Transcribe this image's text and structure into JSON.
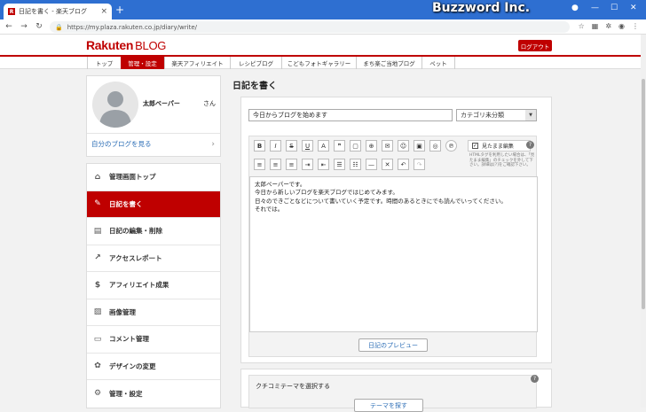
{
  "browser": {
    "tab_title": "日記を書く - 楽天ブログ",
    "url": "https://my.plaza.rakuten.co.jp/diary/write/",
    "watermark": "Buzzword Inc."
  },
  "header": {
    "logo_rakuten": "Rakuten",
    "logo_blog": "BLOG",
    "logout_label": "ログアウト"
  },
  "gnav": [
    {
      "label": "トップ",
      "active": false
    },
    {
      "label": "管理・設定",
      "active": true
    },
    {
      "label": "楽天アフィリエイト",
      "active": false
    },
    {
      "label": "レシピブログ",
      "active": false
    },
    {
      "label": "こどもフォトギャラリー",
      "active": false
    },
    {
      "label": "まち楽ご当地ブログ",
      "active": false
    },
    {
      "label": "ペット",
      "active": false
    }
  ],
  "profile": {
    "name": "太郎ベーパー",
    "honorific": "さん",
    "my_blog_link": "自分のブログを見る"
  },
  "menu": [
    {
      "label": "管理画面トップ",
      "icon": "home-icon",
      "active": false
    },
    {
      "label": "日記を書く",
      "icon": "pencil-icon",
      "active": true
    },
    {
      "label": "日記の編集・削除",
      "icon": "document-icon",
      "active": false
    },
    {
      "label": "アクセスレポート",
      "icon": "trend-chart-icon",
      "active": false
    },
    {
      "label": "アフィリエイト成果",
      "icon": "money-bag-icon",
      "active": false
    },
    {
      "label": "画像管理",
      "icon": "image-icon",
      "active": false
    },
    {
      "label": "コメント管理",
      "icon": "comment-icon",
      "active": false
    },
    {
      "label": "デザインの変更",
      "icon": "palette-icon",
      "active": false
    },
    {
      "label": "管理・設定",
      "icon": "gear-icon",
      "active": false
    }
  ],
  "page_title": "日記を書く",
  "editor": {
    "title_value": "今日からブログを始めます",
    "category_value": "カテゴリ未分類",
    "wysiwyg_label": "見たまま編集",
    "wysiwyg_checked": "✓",
    "tip_text": "HTMLタグを利用したい場合は、「見たまま編集」のチェックを外して下さい。詳細は[?]をご確認下さい。",
    "body_text": "太郎ペーパーです。\n今日から新しいブログを楽天ブログではじめてみます。\n日々のできごとなどについて書いていく予定です。時間のあるときにでも読んでいってください。\nそれでは。",
    "preview_label": "日記のプレビュー",
    "toolbar_row1": [
      "B",
      "I",
      "S",
      "U",
      "A",
      "❞",
      "▢",
      "⊕",
      "✉",
      "☺",
      "▣",
      "◎",
      "℗"
    ],
    "toolbar_row2": [
      "≡",
      "≡",
      "≡",
      "⇥",
      "⇤",
      "☰",
      "☷",
      "—",
      "✕",
      "↶",
      "↷"
    ]
  },
  "theme": {
    "title": "クチコミテーマを選択する",
    "button_label": "テーマを探す"
  }
}
